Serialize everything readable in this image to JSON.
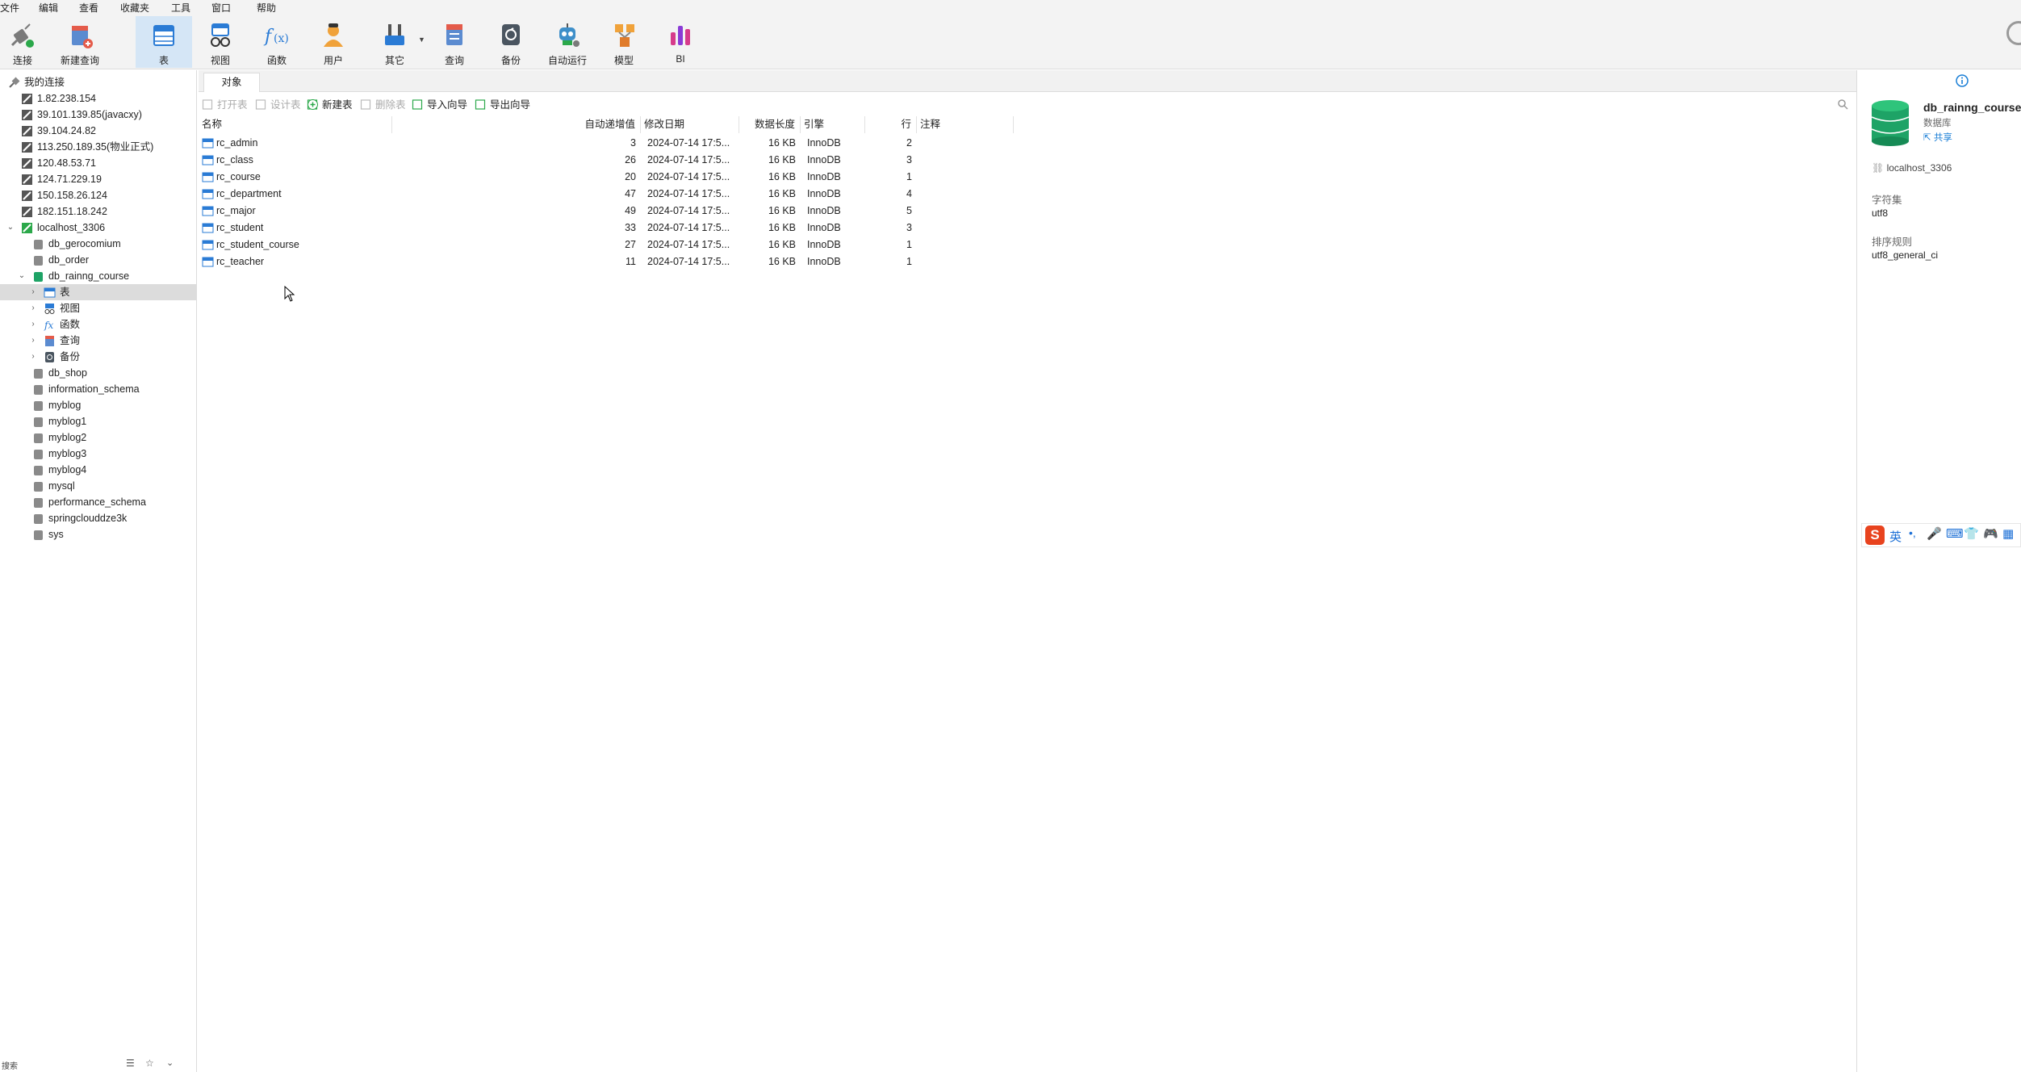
{
  "menu": [
    "文件",
    "编辑",
    "查看",
    "收藏夹",
    "工具",
    "窗口",
    "帮助"
  ],
  "toolbar": [
    {
      "label": "连接",
      "icon": "connection-plug-icon"
    },
    {
      "label": "新建查询",
      "icon": "new-query-icon"
    },
    {
      "label": "表",
      "icon": "table-icon",
      "active": true
    },
    {
      "label": "视图",
      "icon": "view-glasses-icon"
    },
    {
      "label": "函数",
      "icon": "function-fx-icon"
    },
    {
      "label": "用户",
      "icon": "user-icon"
    },
    {
      "label": "其它",
      "icon": "tools-icon"
    },
    {
      "label": "查询",
      "icon": "query-icon"
    },
    {
      "label": "备份",
      "icon": "backup-icon"
    },
    {
      "label": "自动运行",
      "icon": "robot-icon"
    },
    {
      "label": "模型",
      "icon": "model-icon"
    },
    {
      "label": "BI",
      "icon": "bi-chart-icon"
    }
  ],
  "tree": {
    "root": "我的连接",
    "connections": [
      "1.82.238.154",
      "39.101.139.85(javacxy)",
      "39.104.24.82",
      "113.250.189.35(物业正式)",
      "120.48.53.71",
      "124.71.229.19",
      "150.158.26.124",
      "182.151.18.242"
    ],
    "local": "localhost_3306",
    "dbs_before": [
      "db_gerocomium",
      "db_order"
    ],
    "open_db": "db_rainng_course",
    "open_children": [
      "表",
      "视图",
      "函数",
      "查询",
      "备份"
    ],
    "dbs_after": [
      "db_shop",
      "information_schema",
      "myblog",
      "myblog1",
      "myblog2",
      "myblog3",
      "myblog4",
      "mysql",
      "performance_schema",
      "springclouddze3k",
      "sys"
    ],
    "search_label": "搜索"
  },
  "tabs": {
    "objects": "对象"
  },
  "objbar": [
    {
      "label": "打开表",
      "disabled": true,
      "icon": "open-table-icon"
    },
    {
      "label": "设计表",
      "disabled": true,
      "icon": "design-table-icon"
    },
    {
      "label": "新建表",
      "disabled": false,
      "icon": "new-table-icon"
    },
    {
      "label": "删除表",
      "disabled": true,
      "icon": "delete-table-icon"
    },
    {
      "label": "导入向导",
      "disabled": false,
      "icon": "import-wizard-icon"
    },
    {
      "label": "导出向导",
      "disabled": false,
      "icon": "export-wizard-icon"
    }
  ],
  "columns": [
    "名称",
    "自动递增值",
    "修改日期",
    "数据长度",
    "引擎",
    "行",
    "注释"
  ],
  "rows": [
    {
      "name": "rc_admin",
      "auto": "3",
      "date": "2024-07-14 17:5...",
      "size": "16 KB",
      "engine": "InnoDB",
      "rows": "2"
    },
    {
      "name": "rc_class",
      "auto": "26",
      "date": "2024-07-14 17:5...",
      "size": "16 KB",
      "engine": "InnoDB",
      "rows": "3"
    },
    {
      "name": "rc_course",
      "auto": "20",
      "date": "2024-07-14 17:5...",
      "size": "16 KB",
      "engine": "InnoDB",
      "rows": "1"
    },
    {
      "name": "rc_department",
      "auto": "47",
      "date": "2024-07-14 17:5...",
      "size": "16 KB",
      "engine": "InnoDB",
      "rows": "4"
    },
    {
      "name": "rc_major",
      "auto": "49",
      "date": "2024-07-14 17:5...",
      "size": "16 KB",
      "engine": "InnoDB",
      "rows": "5"
    },
    {
      "name": "rc_student",
      "auto": "33",
      "date": "2024-07-14 17:5...",
      "size": "16 KB",
      "engine": "InnoDB",
      "rows": "3"
    },
    {
      "name": "rc_student_course",
      "auto": "27",
      "date": "2024-07-14 17:5...",
      "size": "16 KB",
      "engine": "InnoDB",
      "rows": "1"
    },
    {
      "name": "rc_teacher",
      "auto": "11",
      "date": "2024-07-14 17:5...",
      "size": "16 KB",
      "engine": "InnoDB",
      "rows": "1"
    }
  ],
  "info": {
    "db_name": "db_rainng_course",
    "db_type": "数据库",
    "share": "共享",
    "host": "localhost_3306",
    "charset_label": "字符集",
    "charset": "utf8",
    "collation_label": "排序规则",
    "collation": "utf8_general_ci"
  },
  "ime": {
    "lang": "英"
  },
  "colors": {
    "accent": "#1b7fd6",
    "active_tab": "#d5e6f6",
    "selected_row": "#dcdcdc",
    "db_green": "#1ea366"
  }
}
